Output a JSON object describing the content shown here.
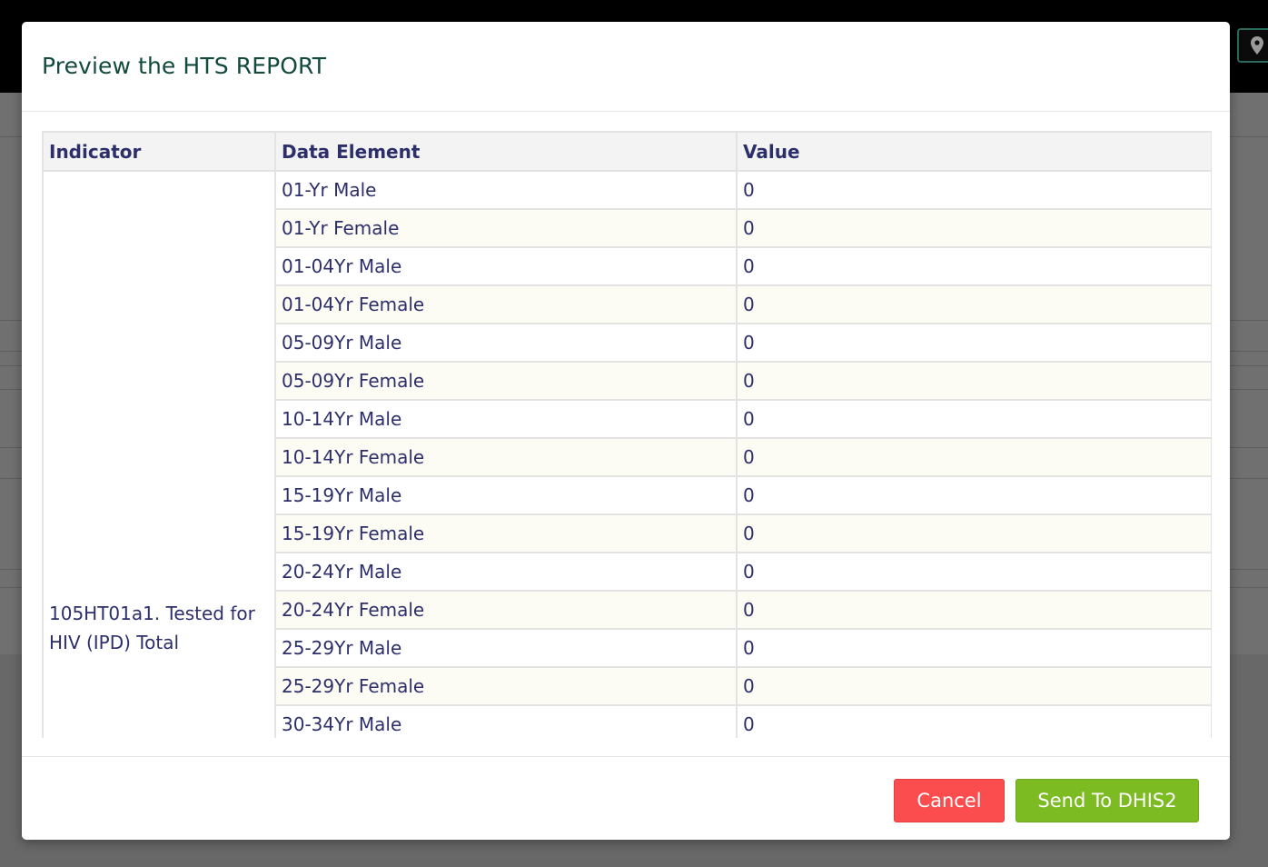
{
  "modal": {
    "title": "Preview the HTS REPORT",
    "table": {
      "headers": [
        "Indicator",
        "Data Element",
        "Value"
      ],
      "indicator": "105HT01a1. Tested for HIV (IPD) Total",
      "rows": [
        {
          "element": "01-Yr Male",
          "value": "0"
        },
        {
          "element": "01-Yr Female",
          "value": "0"
        },
        {
          "element": "01-04Yr Male",
          "value": "0"
        },
        {
          "element": "01-04Yr Female",
          "value": "0"
        },
        {
          "element": "05-09Yr Male",
          "value": "0"
        },
        {
          "element": "05-09Yr Female",
          "value": "0"
        },
        {
          "element": "10-14Yr Male",
          "value": "0"
        },
        {
          "element": "10-14Yr Female",
          "value": "0"
        },
        {
          "element": "15-19Yr Male",
          "value": "0"
        },
        {
          "element": "15-19Yr Female",
          "value": "0"
        },
        {
          "element": "20-24Yr Male",
          "value": "0"
        },
        {
          "element": "20-24Yr Female",
          "value": "0"
        },
        {
          "element": "25-29Yr Male",
          "value": "0"
        },
        {
          "element": "25-29Yr Female",
          "value": "0"
        },
        {
          "element": "30-34Yr Male",
          "value": "0"
        }
      ]
    },
    "buttons": {
      "cancel": "Cancel",
      "send": "Send To DHIS2"
    }
  },
  "background": {
    "location_icon": "map-marker-icon"
  },
  "colors": {
    "title": "#124a3c",
    "text": "#2d2f6b",
    "cancel": "#fb4d4d",
    "send": "#7dbb22"
  }
}
